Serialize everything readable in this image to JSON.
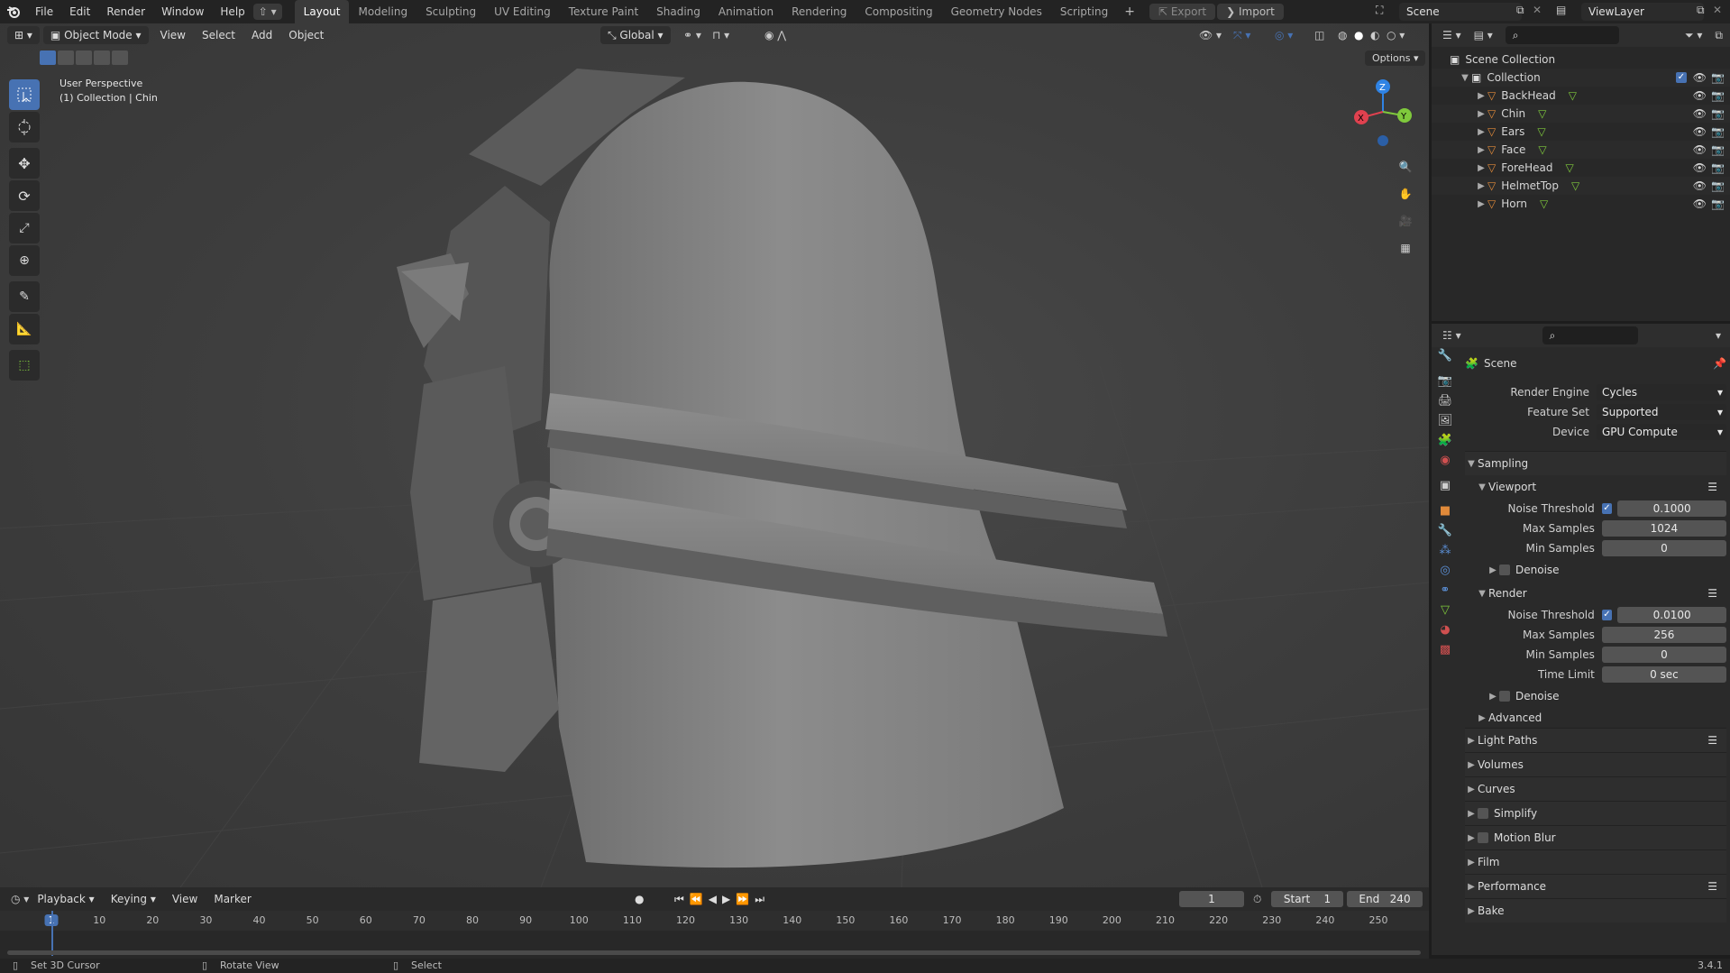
{
  "topbar": {
    "menus": [
      "File",
      "Edit",
      "Render",
      "Window",
      "Help"
    ],
    "workspaces": [
      "Layout",
      "Modeling",
      "Sculpting",
      "UV Editing",
      "Texture Paint",
      "Shading",
      "Animation",
      "Rendering",
      "Compositing",
      "Geometry Nodes",
      "Scripting"
    ],
    "active_workspace": "Layout",
    "export_label": "Export",
    "import_label": "Import",
    "scene_name": "Scene",
    "view_layer": "ViewLayer"
  },
  "viewport": {
    "mode": "Object Mode",
    "menus": [
      "View",
      "Select",
      "Add",
      "Object"
    ],
    "transform_orientation": "Global",
    "options_label": "Options",
    "overlay_title": "User Perspective",
    "overlay_subtitle": "(1) Collection | Chin",
    "gizmo_axes": {
      "x": "X",
      "y": "Y",
      "z": "Z"
    },
    "colors": {
      "x": "#e0414f",
      "y": "#7fc93c",
      "z": "#2f83e4",
      "active_tool": "#4772b3"
    }
  },
  "outliner": {
    "root": "Scene Collection",
    "collection": "Collection",
    "objects": [
      "BackHead",
      "Chin",
      "Ears",
      "Face",
      "ForeHead",
      "HelmetTop",
      "Horn"
    ]
  },
  "properties": {
    "context_title": "Scene",
    "render_engine_label": "Render Engine",
    "render_engine": "Cycles",
    "feature_set_label": "Feature Set",
    "feature_set": "Supported",
    "device_label": "Device",
    "device": "GPU Compute",
    "sampling": "Sampling",
    "viewport": {
      "title": "Viewport",
      "noise_threshold_label": "Noise Threshold",
      "noise_threshold": "0.1000",
      "max_samples_label": "Max Samples",
      "max_samples": "1024",
      "min_samples_label": "Min Samples",
      "min_samples": "0",
      "denoise": "Denoise"
    },
    "render": {
      "title": "Render",
      "noise_threshold_label": "Noise Threshold",
      "noise_threshold": "0.0100",
      "max_samples_label": "Max Samples",
      "max_samples": "256",
      "min_samples_label": "Min Samples",
      "min_samples": "0",
      "time_limit_label": "Time Limit",
      "time_limit": "0 sec",
      "denoise": "Denoise",
      "advanced": "Advanced"
    },
    "panels": [
      "Light Paths",
      "Volumes",
      "Curves",
      "Simplify",
      "Motion Blur",
      "Film",
      "Performance",
      "Bake"
    ]
  },
  "timeline": {
    "menus": [
      "Playback",
      "Keying",
      "View",
      "Marker"
    ],
    "current_frame": "1",
    "start_label": "Start",
    "start": "1",
    "end_label": "End",
    "end": "240",
    "ticks": [
      "1",
      "10",
      "20",
      "30",
      "40",
      "50",
      "60",
      "70",
      "80",
      "90",
      "100",
      "110",
      "120",
      "130",
      "140",
      "150",
      "160",
      "170",
      "180",
      "190",
      "200",
      "210",
      "220",
      "230",
      "240",
      "250"
    ]
  },
  "statusbar": {
    "hint1": "Set 3D Cursor",
    "hint2": "Rotate View",
    "hint3": "Select",
    "version": "3.4.1"
  }
}
